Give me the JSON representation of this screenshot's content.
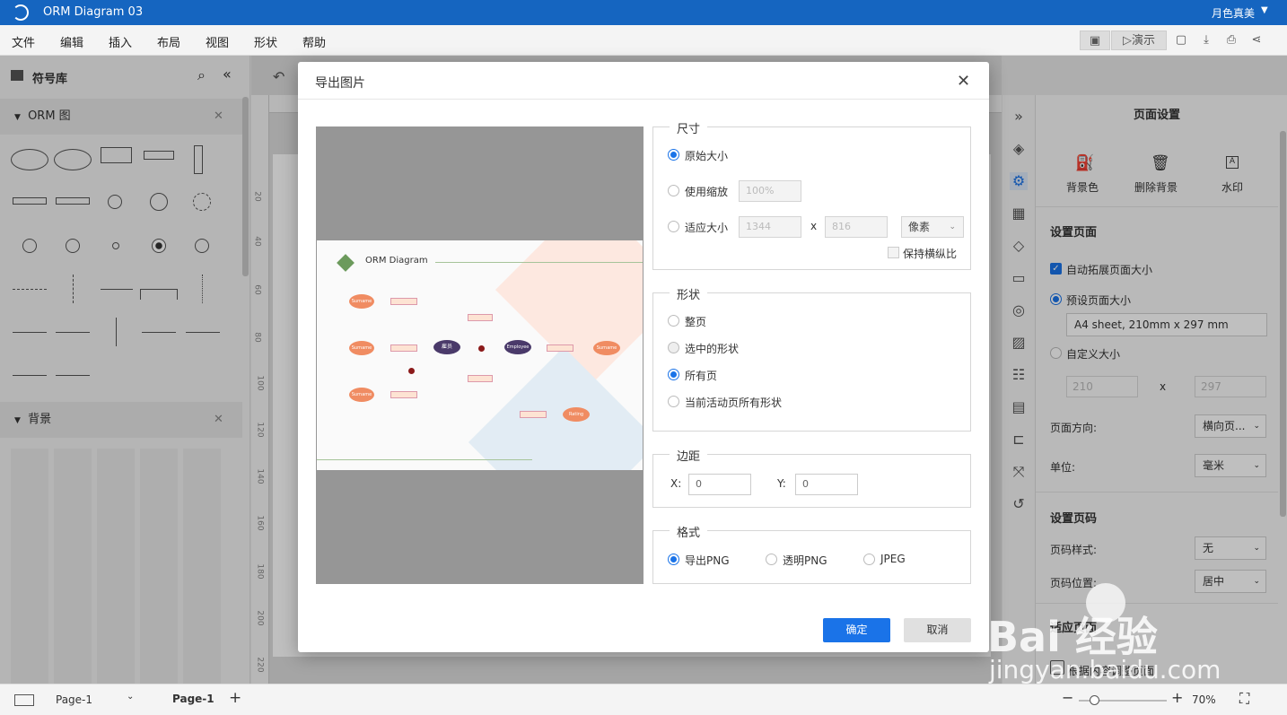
{
  "app": {
    "title": "ORM Diagram 03",
    "user": "月色真美"
  },
  "menu": [
    "文件",
    "编辑",
    "插入",
    "布局",
    "视图",
    "形状",
    "帮助"
  ],
  "toolbar": {
    "present": "演示"
  },
  "library": {
    "title": "符号库",
    "section1": "ORM 图",
    "section2": "背景"
  },
  "dialog": {
    "title": "导出图片",
    "size": {
      "legend": "尺寸",
      "original": "原始大小",
      "scale": "使用缩放",
      "scale_value": "100%",
      "fit": "适应大小",
      "width": "1344",
      "x": "x",
      "height": "816",
      "unit": "像素",
      "keep_ratio": "保持横纵比"
    },
    "shape": {
      "legend": "形状",
      "whole": "整页",
      "selected": "选中的形状",
      "all": "所有页",
      "current": "当前活动页所有形状"
    },
    "margin": {
      "legend": "边距",
      "x_label": "X:",
      "x_value": "0",
      "y_label": "Y:",
      "y_value": "0"
    },
    "format": {
      "legend": "格式",
      "png": "导出PNG",
      "transparent": "透明PNG",
      "jpeg": "JPEG"
    },
    "ok": "确定",
    "cancel": "取消",
    "preview": {
      "title": "ORM Diagram",
      "employee_cn": "雇员",
      "employee_en": "Employee",
      "surname": "Surname",
      "rating": "Rating"
    }
  },
  "right": {
    "header": "页面设置",
    "bg_color": "背景色",
    "delete_bg": "删除背景",
    "watermark": "水印",
    "setup": "设置页面",
    "auto_extend": "自动拓展页面大小",
    "preset": "预设页面大小",
    "preset_value": "A4 sheet, 210mm x 297 mm",
    "custom": "自定义大小",
    "w": "210",
    "x": "x",
    "h": "297",
    "orientation_label": "页面方向:",
    "orientation_value": "横向页...",
    "unit_label": "单位:",
    "unit_value": "毫米",
    "page_number": "设置页码",
    "pn_style_label": "页码样式:",
    "pn_style_value": "无",
    "pn_pos_label": "页码位置:",
    "pn_pos_value": "居中",
    "adapt": "适应页面",
    "adapt_sub": "根据内容调整页面"
  },
  "bottom": {
    "page_select": "Page-1",
    "page_tab": "Page-1",
    "zoom": "70%"
  },
  "ruler_v": [
    "20",
    "40",
    "60",
    "80",
    "100",
    "120",
    "140",
    "160",
    "180",
    "200",
    "220"
  ],
  "watermark": {
    "brand": "Bai 经验",
    "url": "jingyan.baidu.com"
  }
}
